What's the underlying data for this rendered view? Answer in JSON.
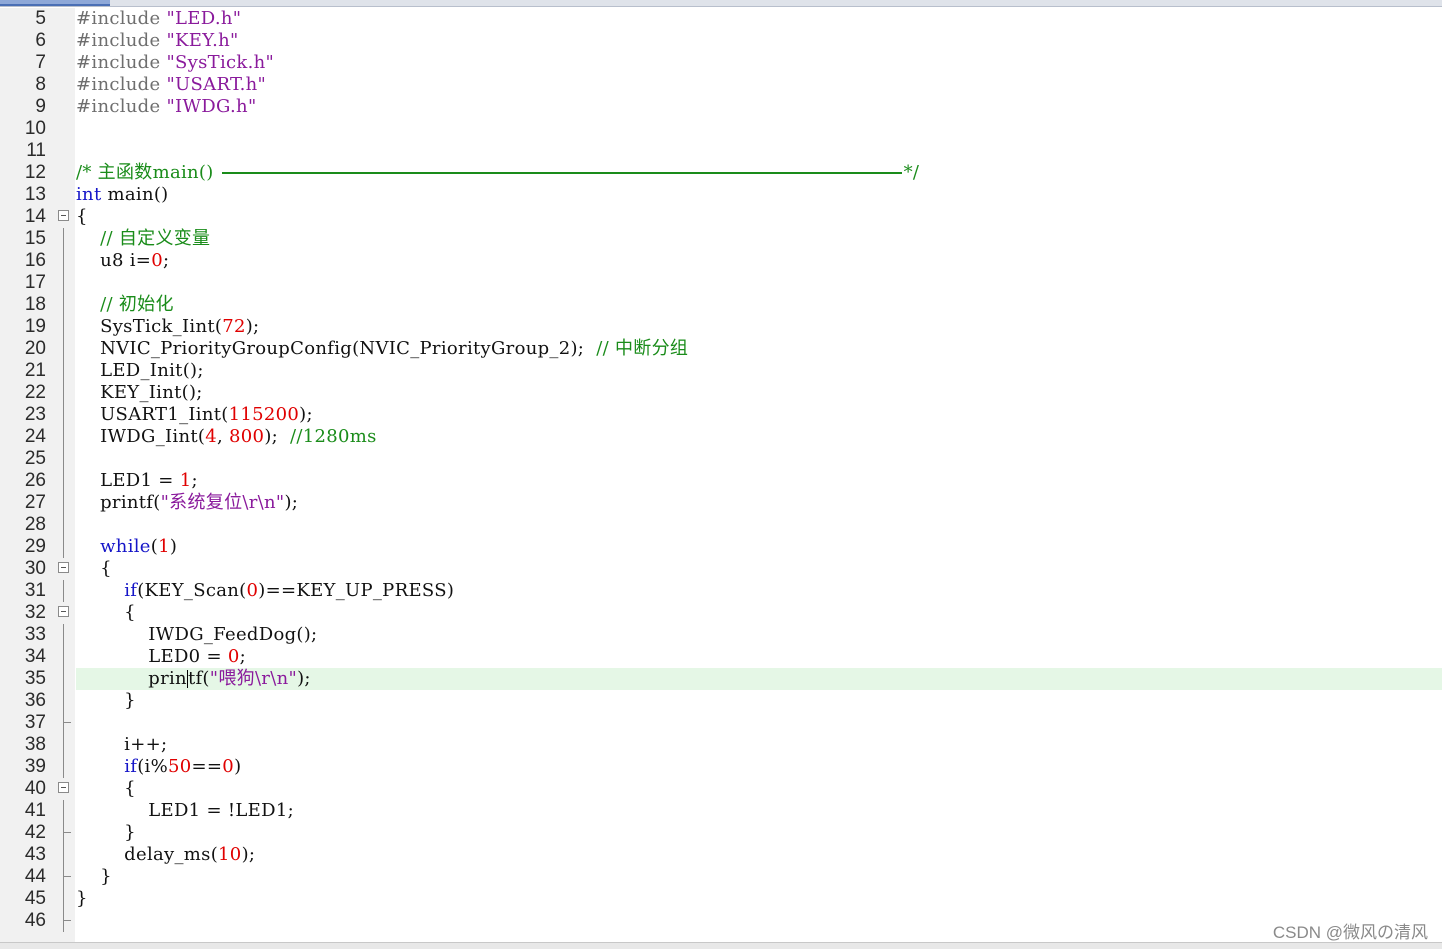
{
  "editor": {
    "lines": [
      {
        "n": "5",
        "fold": "line",
        "tokens": [
          {
            "t": "pp",
            "v": "#include"
          },
          {
            "t": "p",
            "v": " "
          },
          {
            "t": "str",
            "v": "\"LED.h\""
          }
        ]
      },
      {
        "n": "6",
        "fold": "line",
        "tokens": [
          {
            "t": "pp",
            "v": "#include"
          },
          {
            "t": "p",
            "v": " "
          },
          {
            "t": "str",
            "v": "\"KEY.h\""
          }
        ]
      },
      {
        "n": "7",
        "fold": "line",
        "tokens": [
          {
            "t": "pp",
            "v": "#include"
          },
          {
            "t": "p",
            "v": " "
          },
          {
            "t": "str",
            "v": "\"SysTick.h\""
          }
        ]
      },
      {
        "n": "8",
        "fold": "line",
        "tokens": [
          {
            "t": "pp",
            "v": "#include"
          },
          {
            "t": "p",
            "v": " "
          },
          {
            "t": "str",
            "v": "\"USART.h\""
          }
        ]
      },
      {
        "n": "9",
        "fold": "line",
        "tokens": [
          {
            "t": "pp",
            "v": "#include"
          },
          {
            "t": "p",
            "v": " "
          },
          {
            "t": "str",
            "v": "\"IWDG.h\""
          }
        ]
      },
      {
        "n": "10",
        "fold": "none",
        "tokens": []
      },
      {
        "n": "11",
        "fold": "none",
        "tokens": []
      },
      {
        "n": "12",
        "fold": "none",
        "tokens": [
          {
            "t": "cm",
            "v": "/* 主函数main() "
          },
          {
            "t": "rule",
            "v": ""
          },
          {
            "t": "cm",
            "v": "*/"
          }
        ]
      },
      {
        "n": "13",
        "fold": "none",
        "tokens": [
          {
            "t": "kw",
            "v": "int"
          },
          {
            "t": "p",
            "v": " main()"
          }
        ]
      },
      {
        "n": "14",
        "fold": "minus",
        "tokens": [
          {
            "t": "p",
            "v": "{"
          }
        ]
      },
      {
        "n": "15",
        "fold": "line",
        "tokens": [
          {
            "t": "p",
            "v": "    "
          },
          {
            "t": "cm",
            "v": "// 自定义变量"
          }
        ]
      },
      {
        "n": "16",
        "fold": "line",
        "tokens": [
          {
            "t": "p",
            "v": "    u8 i="
          },
          {
            "t": "num",
            "v": "0"
          },
          {
            "t": "p",
            "v": ";"
          }
        ]
      },
      {
        "n": "17",
        "fold": "line",
        "tokens": []
      },
      {
        "n": "18",
        "fold": "line",
        "tokens": [
          {
            "t": "p",
            "v": "    "
          },
          {
            "t": "cm",
            "v": "// 初始化"
          }
        ]
      },
      {
        "n": "19",
        "fold": "line",
        "tokens": [
          {
            "t": "p",
            "v": "    SysTick_Iint("
          },
          {
            "t": "num",
            "v": "72"
          },
          {
            "t": "p",
            "v": ");"
          }
        ]
      },
      {
        "n": "20",
        "fold": "line",
        "tokens": [
          {
            "t": "p",
            "v": "    NVIC_PriorityGroupConfig(NVIC_PriorityGroup_2);  "
          },
          {
            "t": "cm",
            "v": "// 中断分组"
          }
        ]
      },
      {
        "n": "21",
        "fold": "line",
        "tokens": [
          {
            "t": "p",
            "v": "    LED_Init();"
          }
        ]
      },
      {
        "n": "22",
        "fold": "line",
        "tokens": [
          {
            "t": "p",
            "v": "    KEY_Iint();"
          }
        ]
      },
      {
        "n": "23",
        "fold": "line",
        "tokens": [
          {
            "t": "p",
            "v": "    USART1_Iint("
          },
          {
            "t": "num",
            "v": "115200"
          },
          {
            "t": "p",
            "v": ");"
          }
        ]
      },
      {
        "n": "24",
        "fold": "line",
        "tokens": [
          {
            "t": "p",
            "v": "    IWDG_Iint("
          },
          {
            "t": "num",
            "v": "4"
          },
          {
            "t": "p",
            "v": ", "
          },
          {
            "t": "num",
            "v": "800"
          },
          {
            "t": "p",
            "v": ");  "
          },
          {
            "t": "cm",
            "v": "//1280ms"
          }
        ]
      },
      {
        "n": "25",
        "fold": "line",
        "tokens": []
      },
      {
        "n": "26",
        "fold": "line",
        "tokens": [
          {
            "t": "p",
            "v": "    LED1 = "
          },
          {
            "t": "num",
            "v": "1"
          },
          {
            "t": "p",
            "v": ";"
          }
        ]
      },
      {
        "n": "27",
        "fold": "line",
        "tokens": [
          {
            "t": "p",
            "v": "    printf("
          },
          {
            "t": "str",
            "v": "\"系统复位\\r\\n\""
          },
          {
            "t": "p",
            "v": ");"
          }
        ]
      },
      {
        "n": "28",
        "fold": "line",
        "tokens": []
      },
      {
        "n": "29",
        "fold": "line",
        "tokens": [
          {
            "t": "p",
            "v": "    "
          },
          {
            "t": "kw",
            "v": "while"
          },
          {
            "t": "p",
            "v": "("
          },
          {
            "t": "num",
            "v": "1"
          },
          {
            "t": "p",
            "v": ")"
          }
        ]
      },
      {
        "n": "30",
        "fold": "minus",
        "tokens": [
          {
            "t": "p",
            "v": "    {"
          }
        ]
      },
      {
        "n": "31",
        "fold": "line",
        "tokens": [
          {
            "t": "p",
            "v": "        "
          },
          {
            "t": "kw",
            "v": "if"
          },
          {
            "t": "p",
            "v": "(KEY_Scan("
          },
          {
            "t": "num",
            "v": "0"
          },
          {
            "t": "p",
            "v": ")==KEY_UP_PRESS)"
          }
        ]
      },
      {
        "n": "32",
        "fold": "minus",
        "tokens": [
          {
            "t": "p",
            "v": "        {"
          }
        ]
      },
      {
        "n": "33",
        "fold": "line",
        "tokens": [
          {
            "t": "p",
            "v": "            IWDG_FeedDog();"
          }
        ]
      },
      {
        "n": "34",
        "fold": "line",
        "tokens": [
          {
            "t": "p",
            "v": "            LED0 = "
          },
          {
            "t": "num",
            "v": "0"
          },
          {
            "t": "p",
            "v": ";"
          }
        ]
      },
      {
        "n": "35",
        "fold": "line",
        "current": true,
        "tokens": [
          {
            "t": "p",
            "v": "            prin"
          },
          {
            "t": "cursor",
            "v": ""
          },
          {
            "t": "p",
            "v": "tf("
          },
          {
            "t": "str",
            "v": "\"喂狗\\r\\n\""
          },
          {
            "t": "p",
            "v": ");"
          }
        ]
      },
      {
        "n": "36",
        "fold": "line",
        "tokens": [
          {
            "t": "p",
            "v": "        }"
          }
        ]
      },
      {
        "n": "37",
        "fold": "end",
        "tokens": []
      },
      {
        "n": "38",
        "fold": "line",
        "tokens": [
          {
            "t": "p",
            "v": "        i++;"
          }
        ]
      },
      {
        "n": "39",
        "fold": "line",
        "tokens": [
          {
            "t": "p",
            "v": "        "
          },
          {
            "t": "kw",
            "v": "if"
          },
          {
            "t": "p",
            "v": "(i%"
          },
          {
            "t": "num",
            "v": "50"
          },
          {
            "t": "p",
            "v": "=="
          },
          {
            "t": "num",
            "v": "0"
          },
          {
            "t": "p",
            "v": ")"
          }
        ]
      },
      {
        "n": "40",
        "fold": "minus",
        "tokens": [
          {
            "t": "p",
            "v": "        {"
          }
        ]
      },
      {
        "n": "41",
        "fold": "line",
        "tokens": [
          {
            "t": "p",
            "v": "            LED1 = !LED1;"
          }
        ]
      },
      {
        "n": "42",
        "fold": "end",
        "tokens": [
          {
            "t": "p",
            "v": "        }"
          }
        ]
      },
      {
        "n": "43",
        "fold": "line",
        "tokens": [
          {
            "t": "p",
            "v": "        delay_ms("
          },
          {
            "t": "num",
            "v": "10"
          },
          {
            "t": "p",
            "v": ");"
          }
        ]
      },
      {
        "n": "44",
        "fold": "end",
        "tokens": [
          {
            "t": "p",
            "v": "    }"
          }
        ]
      },
      {
        "n": "45",
        "fold": "line",
        "tokens": [
          {
            "t": "p",
            "v": "}"
          }
        ]
      },
      {
        "n": "46",
        "fold": "end",
        "tokens": []
      }
    ]
  },
  "colors": {
    "keyword": "#1515c8",
    "string": "#8a1a9c",
    "number": "#e00000",
    "comment": "#1a8c1a",
    "current_line": "#e5f7e6"
  },
  "watermark": "CSDN @微风の清风"
}
